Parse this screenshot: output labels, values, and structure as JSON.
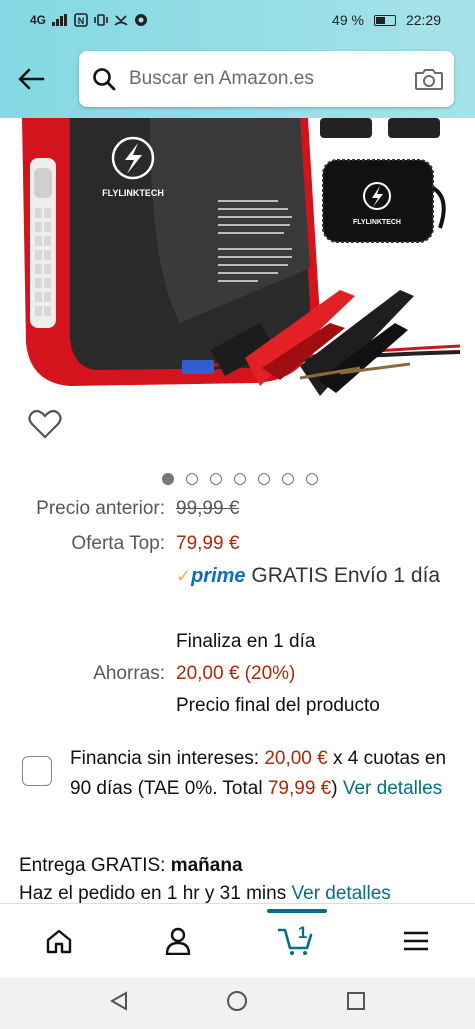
{
  "status_bar": {
    "left_text": "4G",
    "battery": "49 %",
    "time": "22:29"
  },
  "search": {
    "placeholder": "Buscar en Amazon.es"
  },
  "product_image": {
    "brand_main": "FLYLINKTECH",
    "brand_case": "FLYLINKTECH"
  },
  "carousel": {
    "count": 7,
    "active_index": 0
  },
  "prices": {
    "previous_label": "Precio anterior:",
    "previous_value": "99,99 €",
    "offer_label": "Oferta Top:",
    "offer_value": "79,99 €",
    "prime_label": "prime",
    "shipping": "GRATIS Envío 1 día",
    "ends": "Finaliza en 1 día",
    "savings_label": "Ahorras:",
    "savings_value": "20,00 € (20%)",
    "final_price": "Precio final del producto"
  },
  "finance": {
    "text_before": "Financia sin intereses: ",
    "amount": "20,00 €",
    "text_mid": " x 4 cuotas en 90 días (TAE 0%. Total ",
    "total": "79,99 €",
    "text_after": ") ",
    "link": "Ver detalles"
  },
  "delivery": {
    "label": "Entrega GRATIS: ",
    "when": "mañana",
    "order_text": "Haz el pedido en 1 hr y 31 mins ",
    "link": "Ver detalles"
  },
  "bottom_nav": {
    "cart_count": "1"
  }
}
